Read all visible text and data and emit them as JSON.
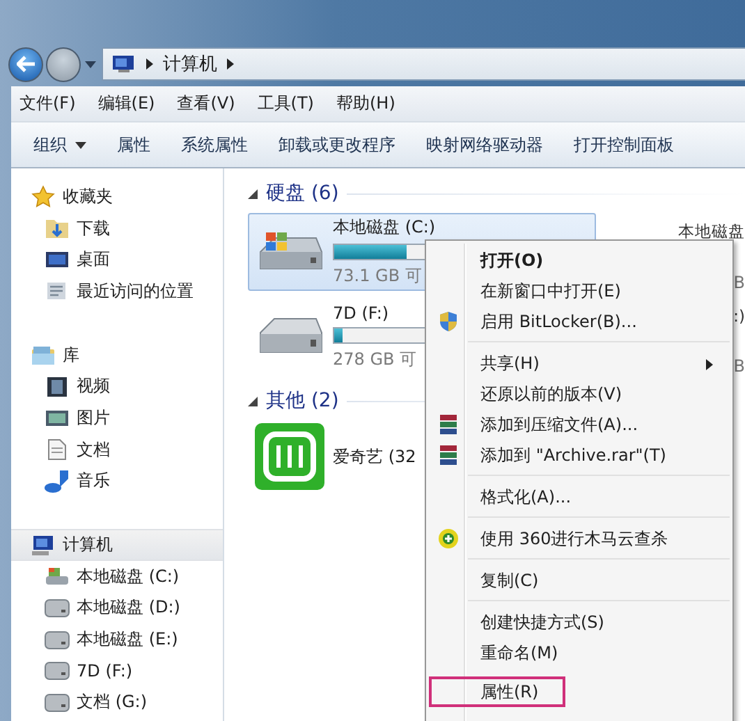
{
  "nav": {
    "back_enabled": true,
    "forward_enabled": false,
    "path": [
      "计算机"
    ]
  },
  "menu_bar": [
    "文件(F)",
    "编辑(E)",
    "查看(V)",
    "工具(T)",
    "帮助(H)"
  ],
  "toolbar": [
    {
      "label": "组织",
      "dropdown": true
    },
    {
      "label": "属性",
      "dropdown": false
    },
    {
      "label": "系统属性",
      "dropdown": false
    },
    {
      "label": "卸载或更改程序",
      "dropdown": false
    },
    {
      "label": "映射网络驱动器",
      "dropdown": false
    },
    {
      "label": "打开控制面板",
      "dropdown": false
    }
  ],
  "sidebar": {
    "groups": [
      {
        "label": "收藏夹",
        "kind": "star",
        "selected": false,
        "items": [
          {
            "label": "下载",
            "kind": "download"
          },
          {
            "label": "桌面",
            "kind": "desktop"
          },
          {
            "label": "最近访问的位置",
            "kind": "recent"
          }
        ]
      },
      {
        "label": "库",
        "kind": "library",
        "selected": false,
        "items": [
          {
            "label": "视频",
            "kind": "video"
          },
          {
            "label": "图片",
            "kind": "picture"
          },
          {
            "label": "文档",
            "kind": "document"
          },
          {
            "label": "音乐",
            "kind": "music"
          }
        ]
      },
      {
        "label": "计算机",
        "kind": "computer",
        "selected": true,
        "items": [
          {
            "label": "本地磁盘 (C:)",
            "kind": "system-drive"
          },
          {
            "label": "本地磁盘 (D:)",
            "kind": "drive"
          },
          {
            "label": "本地磁盘 (E:)",
            "kind": "drive"
          },
          {
            "label": "7D (F:)",
            "kind": "drive"
          },
          {
            "label": "文档 (G:)",
            "kind": "drive"
          }
        ]
      }
    ]
  },
  "sections": [
    {
      "title": "硬盘 (6)",
      "expanded": true,
      "items": [
        {
          "kind": "system-drive",
          "name": "本地磁盘 (C:)",
          "selected": true,
          "level": 0.28,
          "free": "73.1 GB 可"
        },
        {
          "kind": "partial",
          "name": "本地磁盘",
          "free": "B"
        },
        {
          "kind": "drive",
          "name": "7D (F:)",
          "selected": false,
          "level": 0.03,
          "free": "278 GB 可"
        },
        {
          "kind": "partial",
          "name": ":)",
          "free": "B"
        }
      ]
    },
    {
      "title": "其他 (2)",
      "expanded": true,
      "items": [
        {
          "kind": "app",
          "name": "爱奇艺 (32",
          "selected": false
        }
      ]
    }
  ],
  "context_menu": {
    "groups": [
      [
        {
          "label": "打开(O)",
          "bold": true,
          "kind": "plain",
          "submenu": false,
          "highlighted": false
        },
        {
          "label": "在新窗口中打开(E)",
          "bold": false,
          "kind": "plain",
          "submenu": false,
          "highlighted": false
        },
        {
          "label": "启用 BitLocker(B)...",
          "bold": false,
          "kind": "shield",
          "submenu": false,
          "highlighted": false
        }
      ],
      [
        {
          "label": "共享(H)",
          "bold": false,
          "kind": "plain",
          "submenu": true,
          "highlighted": false
        },
        {
          "label": "还原以前的版本(V)",
          "bold": false,
          "kind": "plain",
          "submenu": false,
          "highlighted": false
        },
        {
          "label": "添加到压缩文件(A)...",
          "bold": false,
          "kind": "archive",
          "submenu": false,
          "highlighted": false
        },
        {
          "label": "添加到 \"Archive.rar\"(T)",
          "bold": false,
          "kind": "archive",
          "submenu": false,
          "highlighted": false
        }
      ],
      [
        {
          "label": "格式化(A)...",
          "bold": false,
          "kind": "plain",
          "submenu": false,
          "highlighted": false
        }
      ],
      [
        {
          "label": "使用 360进行木马云查杀",
          "bold": false,
          "kind": "antivirus",
          "submenu": false,
          "highlighted": false
        }
      ],
      [
        {
          "label": "复制(C)",
          "bold": false,
          "kind": "plain",
          "submenu": false,
          "highlighted": false
        }
      ],
      [
        {
          "label": "创建快捷方式(S)",
          "bold": false,
          "kind": "plain",
          "submenu": false,
          "highlighted": false
        },
        {
          "label": "重命名(M)",
          "bold": false,
          "kind": "plain",
          "submenu": false,
          "highlighted": false
        },
        {
          "label": "属性(R)",
          "bold": false,
          "kind": "plain",
          "submenu": false,
          "highlighted": true
        }
      ]
    ]
  }
}
